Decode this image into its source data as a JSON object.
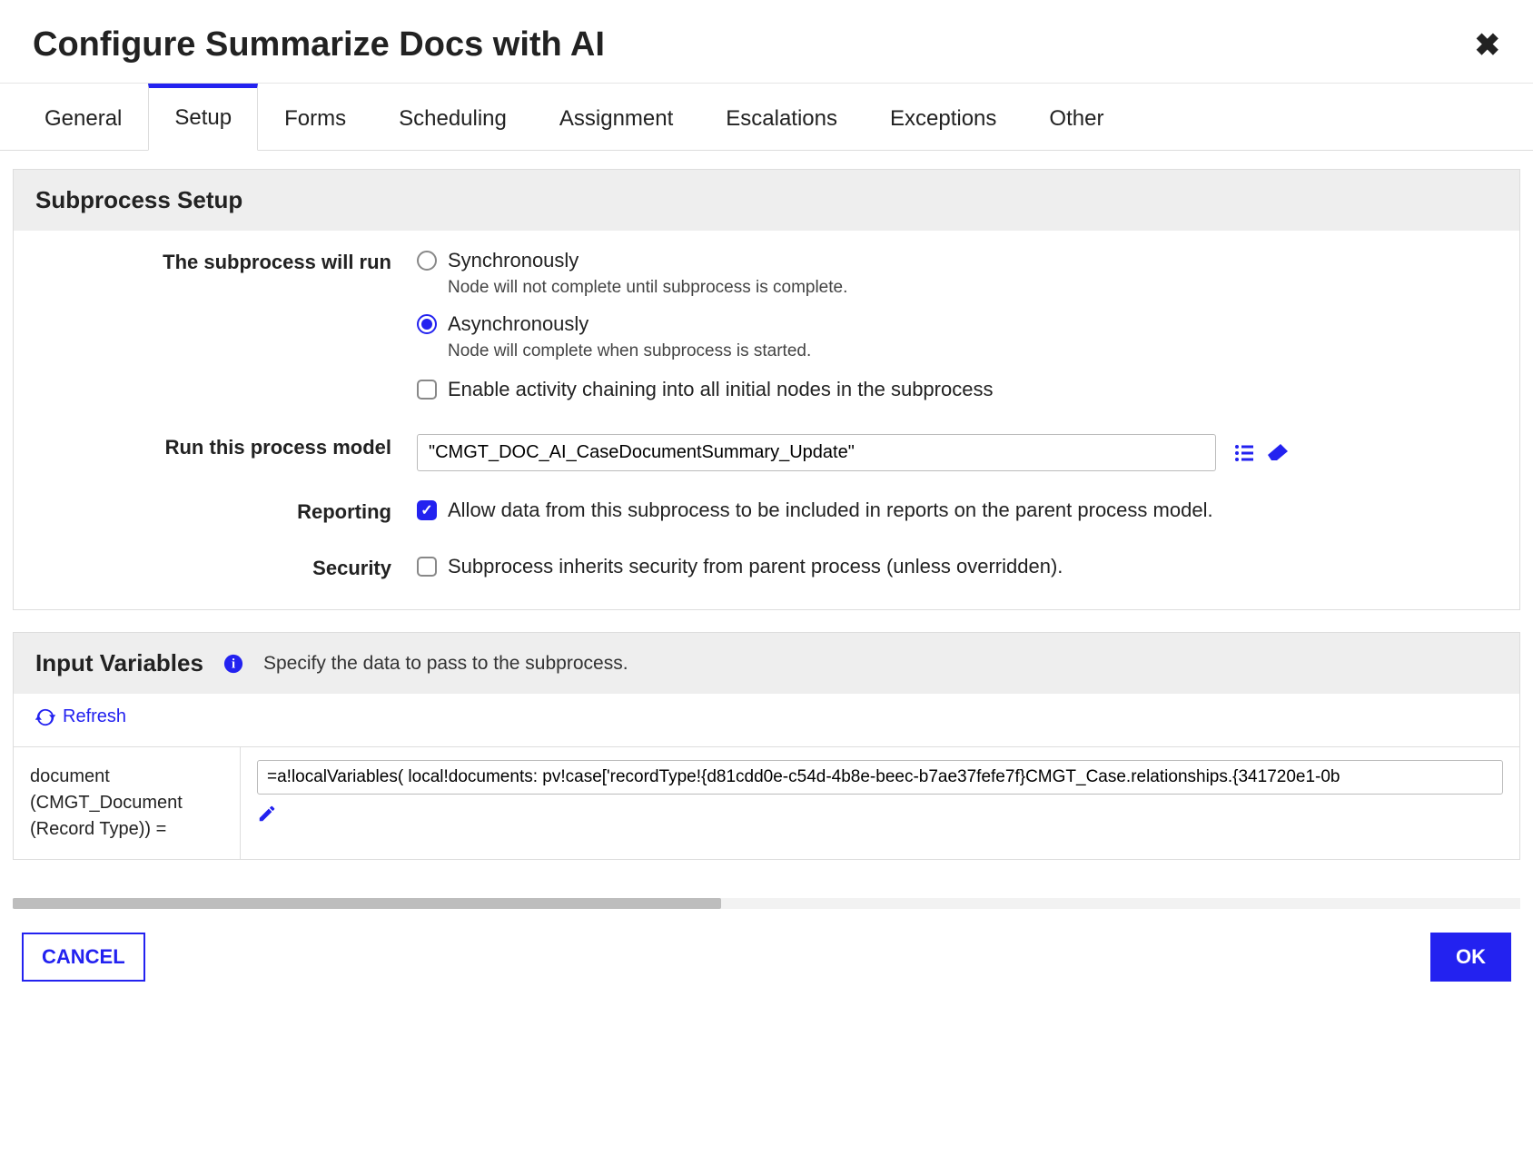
{
  "dialog": {
    "title": "Configure Summarize Docs with AI"
  },
  "tabs": [
    "General",
    "Setup",
    "Forms",
    "Scheduling",
    "Assignment",
    "Escalations",
    "Exceptions",
    "Other"
  ],
  "active_tab_index": 1,
  "subprocess_setup": {
    "heading": "Subprocess Setup",
    "rows": {
      "run_mode": {
        "label": "The subprocess will run",
        "options": [
          {
            "label": "Synchronously",
            "desc": "Node will not complete until subprocess is complete.",
            "selected": false
          },
          {
            "label": "Asynchronously",
            "desc": "Node will complete when subprocess is started.",
            "selected": true
          }
        ],
        "chain_checkbox": {
          "label": "Enable activity chaining into all initial nodes in the subprocess",
          "checked": false
        }
      },
      "process_model": {
        "label": "Run this process model",
        "value": "\"CMGT_DOC_AI_CaseDocumentSummary_Update\""
      },
      "reporting": {
        "label": "Reporting",
        "checkbox": {
          "label": "Allow data from this subprocess to be included in reports on the parent process model.",
          "checked": true
        }
      },
      "security": {
        "label": "Security",
        "checkbox": {
          "label": "Subprocess inherits security from parent process (unless overridden).",
          "checked": false
        }
      }
    }
  },
  "input_variables": {
    "heading": "Input Variables",
    "hint": "Specify the data to pass to the subprocess.",
    "refresh_label": "Refresh",
    "rows": [
      {
        "name": "document (CMGT_Document (Record Type)) =",
        "value": "=a!localVariables( local!documents: pv!case['recordType!{d81cdd0e-c54d-4b8e-beec-b7ae37fefe7f}CMGT_Case.relationships.{341720e1-0b"
      }
    ]
  },
  "footer": {
    "cancel": "CANCEL",
    "ok": "OK"
  }
}
